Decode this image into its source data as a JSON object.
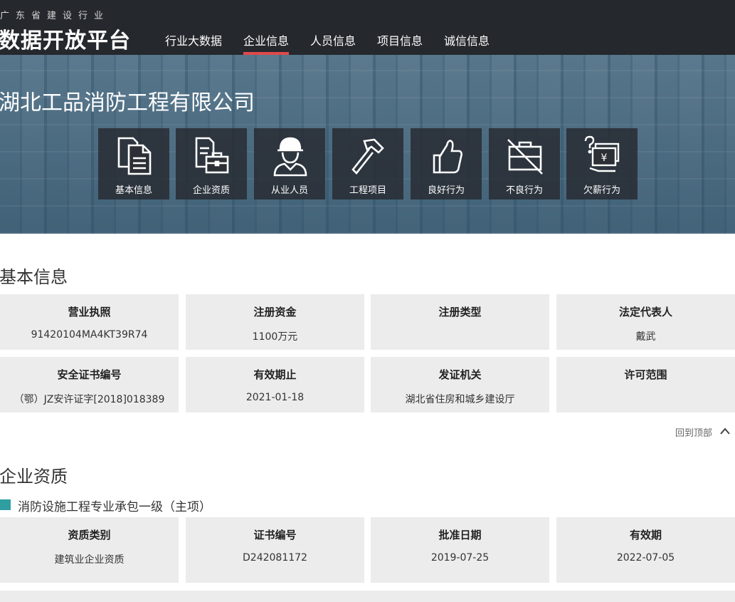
{
  "header": {
    "sub_title": "广东省建设行业",
    "main_title": "数据开放平台",
    "nav": [
      {
        "label": "行业大数据",
        "active": false
      },
      {
        "label": "企业信息",
        "active": true
      },
      {
        "label": "人员信息",
        "active": false
      },
      {
        "label": "项目信息",
        "active": false
      },
      {
        "label": "诚信信息",
        "active": false
      }
    ],
    "accent_color": "#e0494b"
  },
  "hero": {
    "company_name": "湖北工品消防工程有限公司",
    "tiles": [
      {
        "label": "基本信息",
        "icon": "document-icon"
      },
      {
        "label": "企业资质",
        "icon": "certificate-briefcase-icon"
      },
      {
        "label": "从业人员",
        "icon": "worker-helmet-icon"
      },
      {
        "label": "工程项目",
        "icon": "hammer-icon"
      },
      {
        "label": "良好行为",
        "icon": "thumbs-up-icon"
      },
      {
        "label": "不良行为",
        "icon": "briefcase-crossed-icon"
      },
      {
        "label": "欠薪行为",
        "icon": "unpaid-wage-icon"
      }
    ]
  },
  "basic_info": {
    "title": "基本信息",
    "rows": [
      [
        {
          "label": "营业执照",
          "value": "91420104MA4KT39R74"
        },
        {
          "label": "注册资金",
          "value": "1100万元"
        },
        {
          "label": "注册类型",
          "value": ""
        },
        {
          "label": "法定代表人",
          "value": "戴武"
        }
      ],
      [
        {
          "label": "安全证书编号",
          "value": "（鄂）JZ安许证字[2018]018389"
        },
        {
          "label": "有效期止",
          "value": "2021-01-18"
        },
        {
          "label": "发证机关",
          "value": "湖北省住房和城乡建设厅"
        },
        {
          "label": "许可范围",
          "value": ""
        }
      ]
    ]
  },
  "back_to_top": "回到顶部",
  "qualification": {
    "title": "企业资质",
    "item_title": "消防设施工程专业承包一级（主项）",
    "marker_color": "#2e9ea0",
    "cells": [
      {
        "label": "资质类别",
        "value": "建筑业企业资质"
      },
      {
        "label": "证书编号",
        "value": "D242081172"
      },
      {
        "label": "批准日期",
        "value": "2019-07-25"
      },
      {
        "label": "有效期",
        "value": "2022-07-05"
      }
    ]
  }
}
